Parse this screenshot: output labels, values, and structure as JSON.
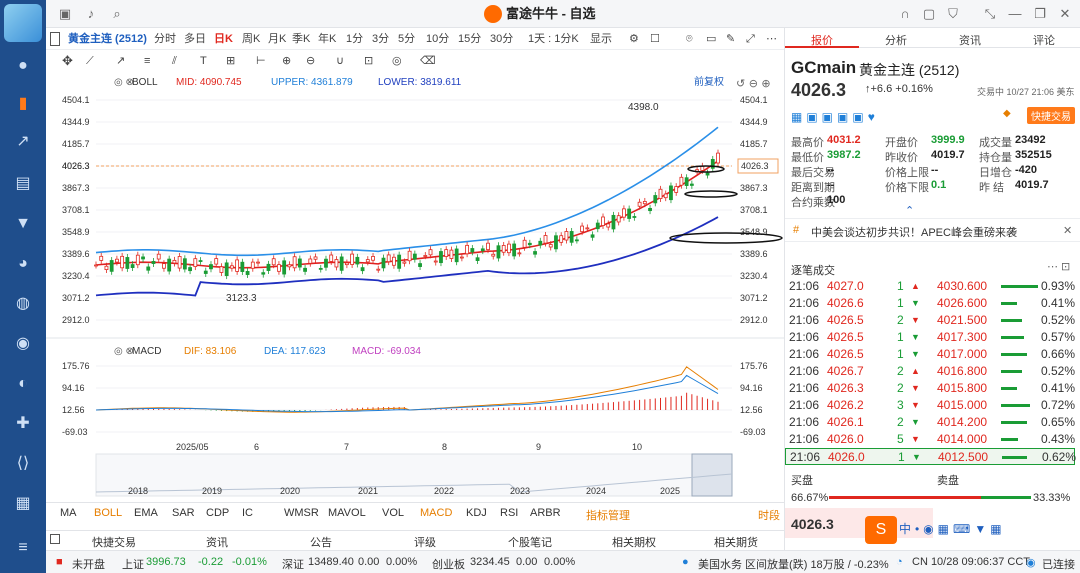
{
  "app": {
    "title": "富途牛牛 - 自选"
  },
  "symbol": {
    "name": "黄金主连 (2512)"
  },
  "timeframes": [
    "分时",
    "多日",
    "日K",
    "周K",
    "月K",
    "季K",
    "年K",
    "1分",
    "3分",
    "5分",
    "10分",
    "15分",
    "30分",
    "1天 : 1分K",
    "显示"
  ],
  "active_timeframe": "日K",
  "chart": {
    "boll": {
      "label": "BOLL",
      "mid": "MID: 4090.745",
      "upper": "UPPER: 4361.879",
      "lower": "LOWER: 3819.611"
    },
    "adjust": "前复权",
    "price_ticks": [
      "4504.1",
      "4344.9",
      "4185.7",
      "4026.3",
      "3867.3",
      "3708.1",
      "3548.9",
      "3389.6",
      "3230.4",
      "3071.2",
      "2912.0"
    ],
    "high_label": "4398.0",
    "low_label": "3123.3",
    "current_price": "4026.3",
    "macd": {
      "label": "MACD",
      "dif": "DIF: 83.106",
      "dea": "DEA: 117.623",
      "macd": "MACD: -69.034"
    },
    "macd_ticks": [
      "175.76",
      "94.16",
      "12.56",
      "-69.03"
    ],
    "months": [
      "2025/05",
      "6",
      "7",
      "8",
      "9",
      "10"
    ],
    "years": [
      "2018",
      "2019",
      "2020",
      "2021",
      "2022",
      "2023",
      "2024",
      "2025"
    ]
  },
  "indicators": [
    "MA",
    "BOLL",
    "EMA",
    "SAR",
    "CDP",
    "IC",
    "WMSR",
    "MAVOL",
    "VOL",
    "MACD",
    "KDJ",
    "RSI",
    "ARBR"
  ],
  "active_overlay": "BOLL",
  "active_sub": "MACD",
  "indicator_extra": "指标管理",
  "indicator_right": "时段",
  "lower_tabs": [
    "快捷交易",
    "资讯",
    "公告",
    "评级",
    "个股笔记",
    "相关期权",
    "相关期货"
  ],
  "right_tabs": [
    "报价",
    "分析",
    "资讯",
    "评论"
  ],
  "quote": {
    "code": "GCmain",
    "name": "黄金主连 (2512)",
    "price": "4026.3",
    "change": "+6.6",
    "change_pct": "+0.16%",
    "status": "交易中 10/27 21:06 美东",
    "trade_btn": "快捷交易",
    "fields": [
      [
        "最高价",
        "4031.2",
        "开盘价",
        "3999.9",
        "成交量",
        "23492"
      ],
      [
        "最低价",
        "3987.2",
        "昨收价",
        "4019.7",
        "持仓量",
        "352515"
      ],
      [
        "最后交易",
        "--",
        "价格上限",
        "--",
        "日增仓",
        "-420"
      ],
      [
        "距离到期",
        "--",
        "价格下限",
        "0.1",
        "昨 结",
        "4019.7"
      ],
      [
        "合约乘数",
        "100",
        "",
        "",
        "",
        ""
      ]
    ],
    "news": "中美会谈达初步共识！APEC峰会重磅来袭"
  },
  "ticks_title": "逐笔成交",
  "ticks": [
    [
      "21:06",
      "4027.0",
      "1",
      "4030.600",
      "0.93%"
    ],
    [
      "21:06",
      "4026.6",
      "1",
      "4026.600",
      "0.41%"
    ],
    [
      "21:06",
      "4026.5",
      "2",
      "4021.500",
      "0.52%"
    ],
    [
      "21:06",
      "4026.5",
      "1",
      "4017.300",
      "0.57%"
    ],
    [
      "21:06",
      "4026.5",
      "1",
      "4017.000",
      "0.66%"
    ],
    [
      "21:06",
      "4026.7",
      "2",
      "4016.800",
      "0.52%"
    ],
    [
      "21:06",
      "4026.3",
      "2",
      "4015.800",
      "0.41%"
    ],
    [
      "21:06",
      "4026.2",
      "3",
      "4015.000",
      "0.72%"
    ],
    [
      "21:06",
      "4026.1",
      "2",
      "4014.200",
      "0.65%"
    ],
    [
      "21:06",
      "4026.0",
      "5",
      "4014.000",
      "0.43%"
    ],
    [
      "21:06",
      "4026.0",
      "1",
      "4012.500",
      "0.62%"
    ]
  ],
  "orderbook": {
    "buy": "买盘",
    "sell": "卖盘",
    "buy_pct": "66.67%",
    "sell_pct": "33.33%",
    "bid": "4026.3"
  },
  "statusbar": {
    "market": "未开盘",
    "sh_label": "上证",
    "sh_val": "3996.73",
    "sh_chg": "-0.22",
    "sh_pct": "-0.01%",
    "sz_label": "深证",
    "sz_val": "13489.40",
    "sz_chg": "0.00",
    "sz_pct": "0.00%",
    "cy_label": "创业板",
    "cy_val": "3234.45",
    "cy_chg": "0.00",
    "cy_pct": "0.00%",
    "ticker": "美国水务 区间放量(跌) 18万股 / -0.23%",
    "time": "CN 10/28 09:06:37 CCT",
    "conn": "已连接"
  }
}
